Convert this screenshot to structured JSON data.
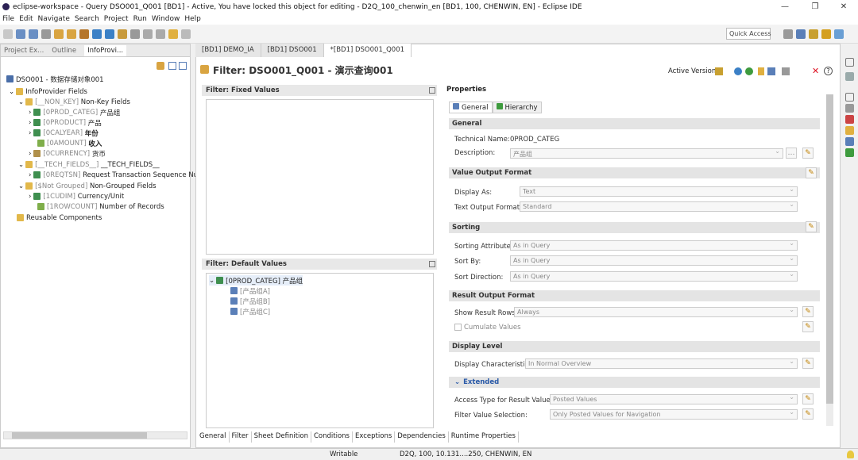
{
  "window": {
    "title": "eclipse-workspace - Query DSO001_Q001 [BD1] - Active, You have locked this object for editing - D2Q_100_chenwin_en [BD1, 100, CHENWIN, EN] - Eclipse IDE"
  },
  "menu": [
    "File",
    "Edit",
    "Navigate",
    "Search",
    "Project",
    "Run",
    "Window",
    "Help"
  ],
  "toolbar": {
    "quick_access": "Quick Access"
  },
  "left": {
    "tabs": [
      "Project Ex...",
      "Outline",
      "InfoProvi..."
    ],
    "root": "DSO001 - 数据存储对象001",
    "tree": [
      {
        "label": "InfoProvider Fields"
      },
      {
        "tech": "[__NON_KEY]",
        "label": "Non-Key Fields"
      },
      {
        "tech": "[0PROD_CATEG]",
        "label": "产品组"
      },
      {
        "tech": "[0PRODUCT]",
        "label": "产品"
      },
      {
        "tech": "[0CALYEAR]",
        "label": "年份"
      },
      {
        "tech": "[0AMOUNT]",
        "label": "收入"
      },
      {
        "tech": "[0CURRENCY]",
        "label": "货币"
      },
      {
        "tech": "[__TECH_FIELDS__]",
        "label": "__TECH_FIELDS__"
      },
      {
        "tech": "[0REQTSN]",
        "label": "Request Transaction Sequence Nu"
      },
      {
        "tech": "[$Not Grouped]",
        "label": "Non-Grouped Fields"
      },
      {
        "tech": "[1CUDIM]",
        "label": "Currency/Unit"
      },
      {
        "tech": "[1ROWCOUNT]",
        "label": "Number of Records"
      },
      {
        "label": "Reusable Components"
      }
    ]
  },
  "editor": {
    "tabs": [
      "[BD1] DEMO_IA",
      "[BD1] DSO001",
      "*[BD1] DSO001_Q001"
    ],
    "title": "Filter: DSO001_Q001 - 演示查询001",
    "active_version": "Active Version",
    "fixed_values_title": "Filter: Fixed Values",
    "default_values_title": "Filter: Default Values",
    "default_tree": {
      "node": "[0PROD_CATEG] 产品组",
      "children": [
        "[产品组A]",
        "[产品组B]",
        "[产品组C]"
      ]
    },
    "properties": {
      "title": "Properties",
      "tabs": [
        "General",
        "Hierarchy"
      ],
      "general": {
        "header": "General",
        "tech_name_label": "Technical Name:",
        "tech_name_value": "0PROD_CATEG",
        "description_label": "Description:",
        "description_value": "产品组"
      },
      "value_output": {
        "header": "Value Output Format",
        "display_as_label": "Display As:",
        "display_as_value": "Text",
        "text_output_label": "Text Output Format:",
        "text_output_value": "Standard"
      },
      "sorting": {
        "header": "Sorting",
        "attr_label": "Sorting Attribute:",
        "attr_value": "As in Query",
        "by_label": "Sort By:",
        "by_value": "As in Query",
        "dir_label": "Sort Direction:",
        "dir_value": "As in Query"
      },
      "result_output": {
        "header": "Result Output Format",
        "rows_label": "Show Result Rows:",
        "rows_value": "Always",
        "cumulate_label": "Cumulate Values"
      },
      "display_level": {
        "header": "Display Level",
        "char_label": "Display Characteristic:",
        "char_value": "In Normal Overview"
      },
      "extended": {
        "header": "Extended",
        "access_label": "Access Type for Result Values:",
        "access_value": "Posted Values",
        "filter_label": "Filter Value Selection:",
        "filter_value": "Only Posted Values for Navigation"
      }
    },
    "bottom_tabs": [
      "General",
      "Filter",
      "Sheet Definition",
      "Conditions",
      "Exceptions",
      "Dependencies",
      "Runtime Properties"
    ]
  },
  "status": {
    "writable": "Writable",
    "connection": "D2Q, 100, 10.131....250, CHENWIN, EN"
  }
}
